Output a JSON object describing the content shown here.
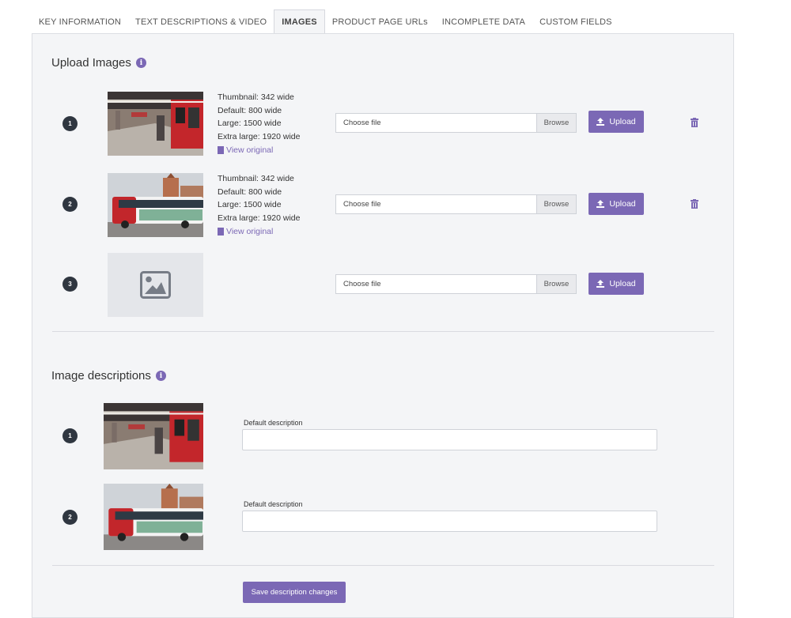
{
  "tabs": [
    {
      "label": "KEY INFORMATION"
    },
    {
      "label": "TEXT DESCRIPTIONS & VIDEO"
    },
    {
      "label": "IMAGES"
    },
    {
      "label": "PRODUCT PAGE URLs"
    },
    {
      "label": "INCOMPLETE DATA"
    },
    {
      "label": "CUSTOM FIELDS"
    }
  ],
  "active_tab": "IMAGES",
  "upload": {
    "title": "Upload Images",
    "info_glyph": "i",
    "rows": [
      {
        "number": "1",
        "image": "train-station-photo",
        "sizes": [
          "Thumbnail: 342 wide",
          "Default: 800 wide",
          "Large: 1500 wide",
          "Extra large: 1920 wide"
        ],
        "view_original": "View original",
        "file_placeholder": "Choose file",
        "browse_label": "Browse",
        "upload_label": "Upload",
        "has_delete": true
      },
      {
        "number": "2",
        "image": "city-bus-photo",
        "sizes": [
          "Thumbnail: 342 wide",
          "Default: 800 wide",
          "Large: 1500 wide",
          "Extra large: 1920 wide"
        ],
        "view_original": "View original",
        "file_placeholder": "Choose file",
        "browse_label": "Browse",
        "upload_label": "Upload",
        "has_delete": true
      },
      {
        "number": "3",
        "image": "image-placeholder-icon",
        "file_placeholder": "Choose file",
        "browse_label": "Browse",
        "upload_label": "Upload",
        "has_delete": false
      }
    ]
  },
  "descriptions": {
    "title": "Image descriptions",
    "info_glyph": "i",
    "rows": [
      {
        "number": "1",
        "image": "train-station-photo",
        "label": "Default description",
        "value": ""
      },
      {
        "number": "2",
        "image": "city-bus-photo",
        "label": "Default description",
        "value": ""
      }
    ],
    "save_label": "Save description changes"
  },
  "colors": {
    "accent": "#7b68b5",
    "badge": "#2f3640",
    "panel_bg": "#f4f5f7"
  }
}
